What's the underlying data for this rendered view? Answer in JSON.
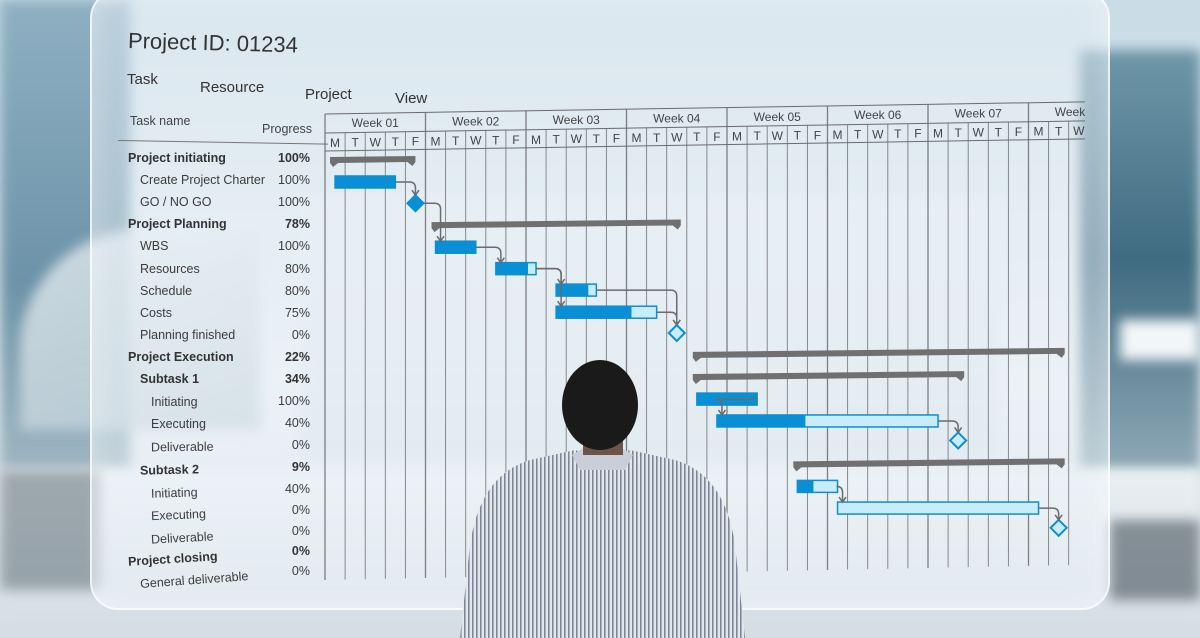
{
  "header": {
    "title": "Project ID: 01234",
    "menu": [
      "Task",
      "Resource",
      "Project",
      "View"
    ]
  },
  "columns": {
    "task_name": "Task name",
    "progress": "Progress"
  },
  "timeline": {
    "weeks": [
      "Week 01",
      "Week 02",
      "Week 03",
      "Week 04",
      "Week 05",
      "Week 06",
      "Week 07",
      "Week"
    ],
    "days": [
      "M",
      "T",
      "W",
      "T",
      "F"
    ],
    "visible_days": 38
  },
  "colors": {
    "bar_done": "#0a8fd4",
    "bar_remaining": "#c8ecfb",
    "bar_border": "#0a8fd4",
    "summary": "#707070",
    "grid": "#6b6b6b",
    "link": "#6b6b6b"
  },
  "tasks": [
    {
      "name": "Project initiating",
      "progress": "100%",
      "level": 0,
      "bold": true,
      "type": "summary",
      "start": 0.25,
      "end": 4.5
    },
    {
      "name": "Create Project Charter",
      "progress": "100%",
      "level": 1,
      "bold": false,
      "type": "task",
      "start": 0.5,
      "end": 3.5,
      "pct": 1.0
    },
    {
      "name": "GO / NO GO",
      "progress": "100%",
      "level": 1,
      "bold": false,
      "type": "milestone",
      "at": 4.5,
      "pct": 1.0
    },
    {
      "name": "Project Planning",
      "progress": "78%",
      "level": 0,
      "bold": true,
      "type": "summary",
      "start": 5.3,
      "end": 17.7
    },
    {
      "name": "WBS",
      "progress": "100%",
      "level": 1,
      "bold": false,
      "type": "task",
      "start": 5.5,
      "end": 7.5,
      "pct": 1.0
    },
    {
      "name": "Resources",
      "progress": "80%",
      "level": 1,
      "bold": false,
      "type": "task",
      "start": 8.5,
      "end": 10.5,
      "pct": 0.8
    },
    {
      "name": "Schedule",
      "progress": "80%",
      "level": 1,
      "bold": false,
      "type": "task",
      "start": 11.5,
      "end": 13.5,
      "pct": 0.8
    },
    {
      "name": "Costs",
      "progress": "75%",
      "level": 1,
      "bold": false,
      "type": "task",
      "start": 11.5,
      "end": 16.5,
      "pct": 0.75
    },
    {
      "name": "Planning finished",
      "progress": "0%",
      "level": 1,
      "bold": false,
      "type": "milestone",
      "at": 17.5,
      "pct": 0
    },
    {
      "name": "Project Execution",
      "progress": "22%",
      "level": 0,
      "bold": true,
      "type": "summary",
      "start": 18.3,
      "end": 36.8
    },
    {
      "name": "Subtask 1",
      "progress": "34%",
      "level": 1,
      "bold": true,
      "type": "summary",
      "start": 18.3,
      "end": 31.8
    },
    {
      "name": "Initiating",
      "progress": "100%",
      "level": 2,
      "bold": false,
      "type": "task",
      "start": 18.5,
      "end": 21.5,
      "pct": 1.0
    },
    {
      "name": "Executing",
      "progress": "40%",
      "level": 2,
      "bold": false,
      "type": "task",
      "start": 19.5,
      "end": 30.5,
      "pct": 0.4
    },
    {
      "name": "Deliverable",
      "progress": "0%",
      "level": 2,
      "bold": false,
      "type": "milestone",
      "at": 31.5,
      "pct": 0
    },
    {
      "name": "Subtask 2",
      "progress": "9%",
      "level": 1,
      "bold": true,
      "type": "summary",
      "start": 23.3,
      "end": 36.8
    },
    {
      "name": "Initiating",
      "progress": "40%",
      "level": 2,
      "bold": false,
      "type": "task",
      "start": 23.5,
      "end": 25.5,
      "pct": 0.4
    },
    {
      "name": "Executing",
      "progress": "0%",
      "level": 2,
      "bold": false,
      "type": "task",
      "start": 25.5,
      "end": 35.5,
      "pct": 0
    },
    {
      "name": "Deliverable",
      "progress": "0%",
      "level": 2,
      "bold": false,
      "type": "milestone",
      "at": 36.5,
      "pct": 0
    },
    {
      "name": "Project closing",
      "progress": "0%",
      "level": 0,
      "bold": true,
      "type": "none"
    },
    {
      "name": "General deliverable",
      "progress": "0%",
      "level": 1,
      "bold": false,
      "type": "none"
    }
  ],
  "links": [
    [
      1,
      2
    ],
    [
      2,
      4
    ],
    [
      4,
      5
    ],
    [
      5,
      6
    ],
    [
      5,
      7
    ],
    [
      6,
      8
    ],
    [
      7,
      8
    ],
    [
      11,
      12
    ],
    [
      12,
      13
    ],
    [
      15,
      16
    ],
    [
      16,
      17
    ]
  ]
}
